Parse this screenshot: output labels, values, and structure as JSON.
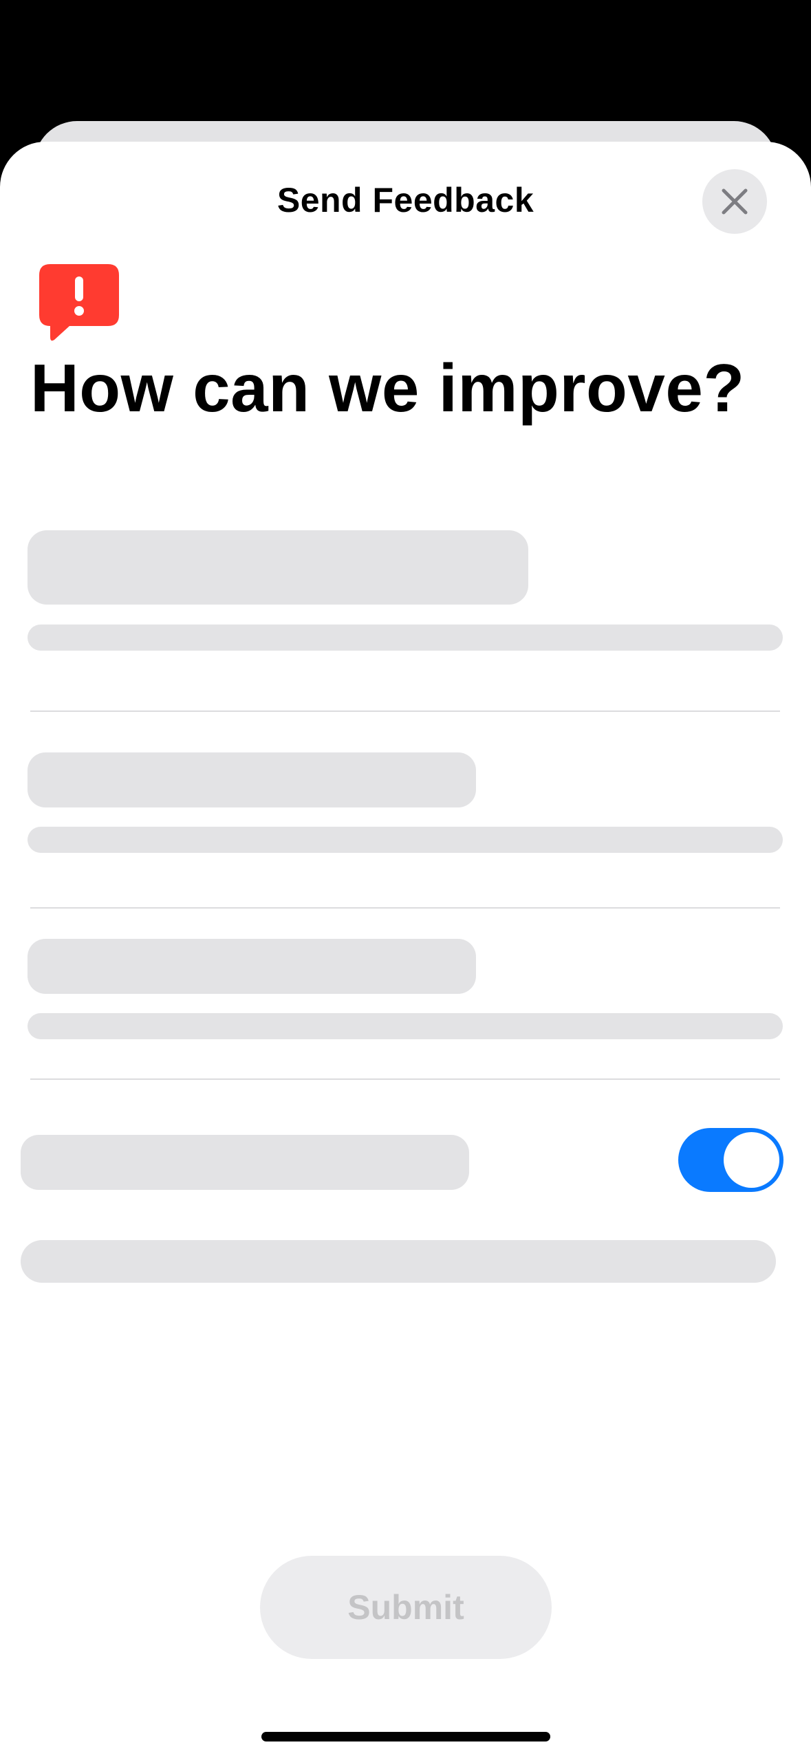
{
  "sheet": {
    "title": "Send Feedback",
    "close_icon": "xmark-icon"
  },
  "header": {
    "icon": "exclamation-bubble-icon",
    "icon_color": "#ff3b30",
    "headline": "How can we improve?"
  },
  "form": {
    "loading": true,
    "toggle_on": true,
    "toggle_color": "#0a7aff"
  },
  "footer": {
    "submit_label": "Submit",
    "submit_enabled": false
  }
}
